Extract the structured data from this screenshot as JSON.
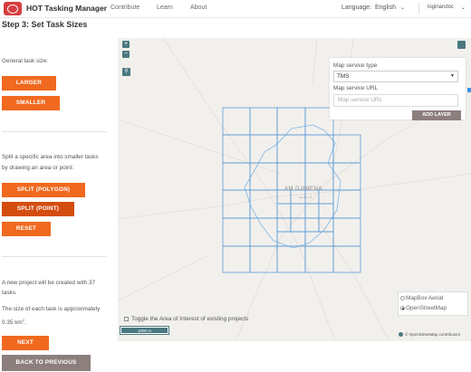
{
  "nav": {
    "brand": "HOT Tasking Manager",
    "links": [
      "Contribute",
      "Learn",
      "About"
    ],
    "language_label": "Language:",
    "language_value": "English",
    "login": "loginandoc"
  },
  "panel": {
    "step_title": "Step 3: Set Task Sizes",
    "general_size_label": "General task size:",
    "btn_larger": "LARGER",
    "btn_smaller": "SMALLER",
    "split_instructions_1": "Split a specific area into smaller tasks",
    "split_instructions_2": "by drawing an area or point:",
    "btn_split_polygon": "SPLIT (POLYGON)",
    "btn_split_point": "SPLIT (POINT)",
    "btn_reset": "RESET",
    "project_info_1": "A new project will be created with 37",
    "project_info_2": "tasks.",
    "task_size_1": "The size of each task is approximately",
    "task_size_2": "0.35 km",
    "task_size_sup": "2",
    "task_size_end": ".",
    "btn_next": "NEXT",
    "btn_back": "BACK TO PREVIOUS"
  },
  "map": {
    "zoom_in": "+",
    "zoom_out": "−",
    "city_label": "AM DJIMENA",
    "service_type_label": "Map service type",
    "service_type_value": "TMS",
    "service_url_label": "Map service URL",
    "service_url_placeholder": "Map service URL",
    "add_layer": "ADD LAYER",
    "basemap_options": [
      "MapBox Aerial",
      "OpenStreetMap"
    ],
    "basemap_selected": "OpenStreetMap",
    "toggle_aoi": "Toggle the Area of Interest of existing projects",
    "scale_text": "1000 m",
    "attribution": "© OpenStreetMap contributors",
    "colors": {
      "grid": "#5b9bd5",
      "accent": "#f0691f",
      "map_control": "#4b7880"
    }
  }
}
